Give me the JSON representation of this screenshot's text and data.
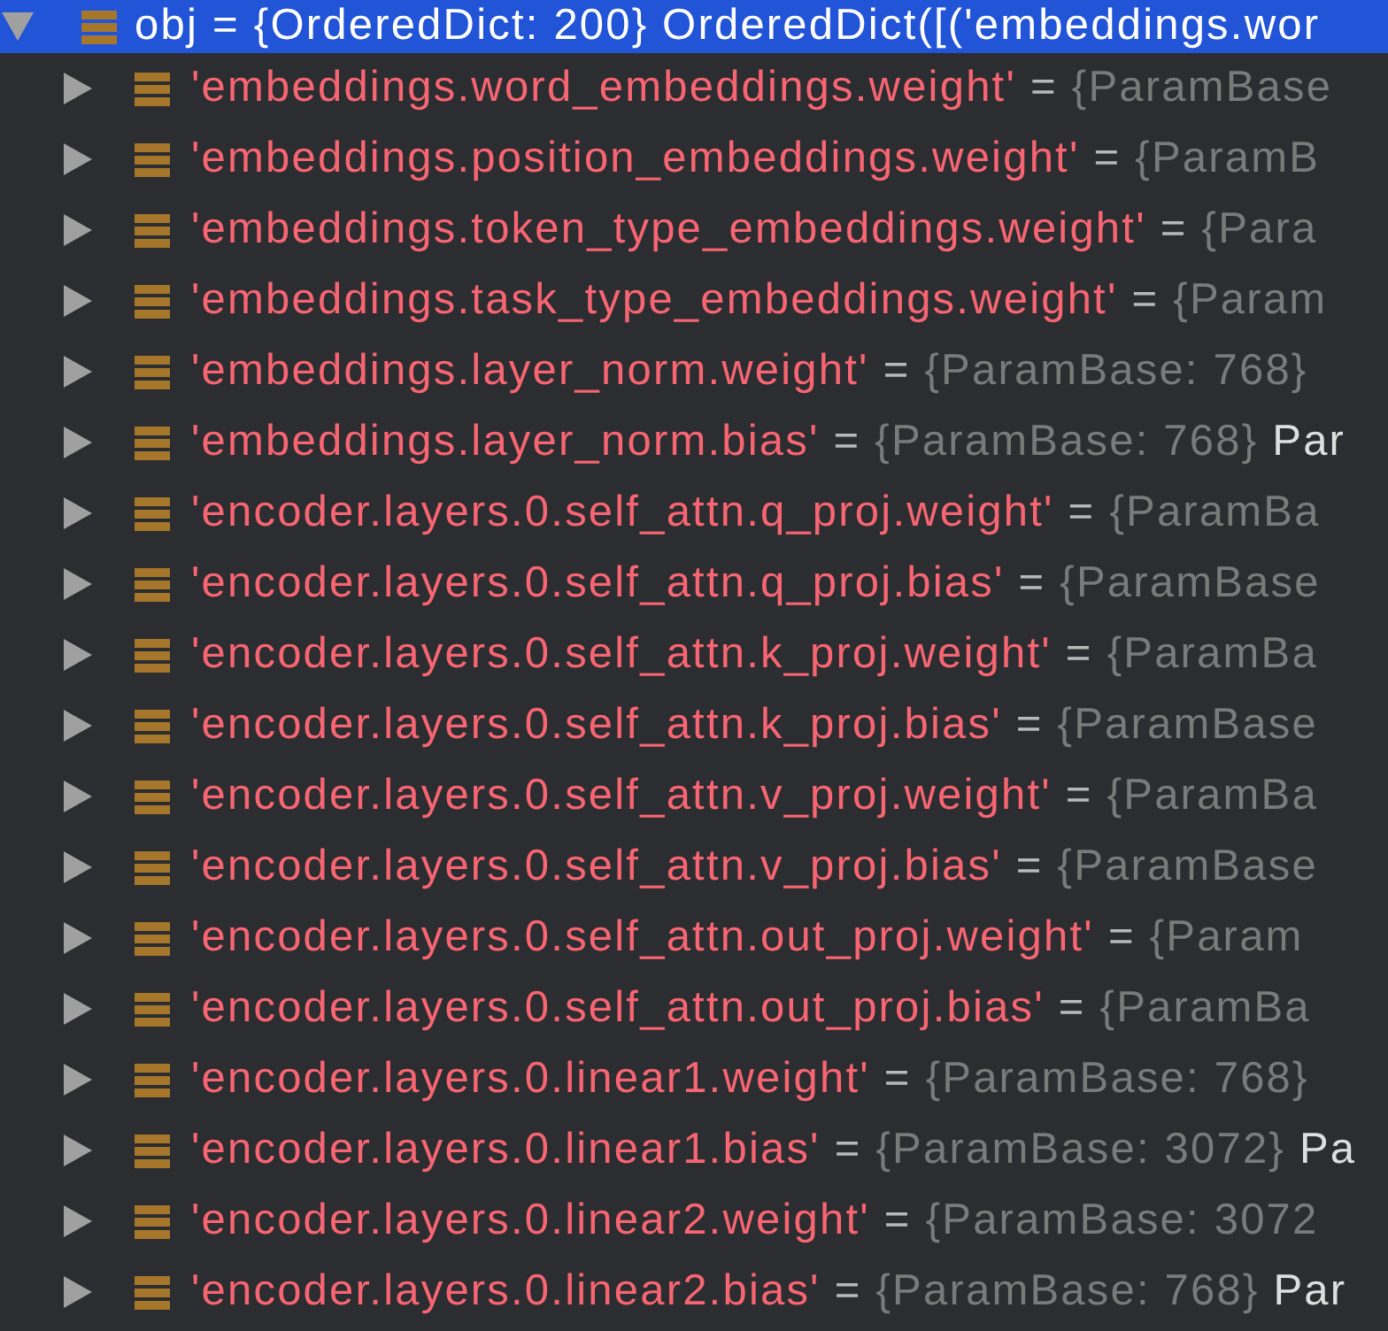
{
  "root": {
    "name": "obj",
    "sep": "=",
    "value": "{OrderedDict: 200} OrderedDict([('embeddings.wor",
    "expanded": true,
    "selected": true
  },
  "items": [
    {
      "key": "'embeddings.word_embeddings.weight'",
      "sep": "=",
      "value": "{ParamBase",
      "expanded": false,
      "selected": false
    },
    {
      "key": "'embeddings.position_embeddings.weight'",
      "sep": "=",
      "value": "{ParamB",
      "expanded": false,
      "selected": false
    },
    {
      "key": "'embeddings.token_type_embeddings.weight'",
      "sep": "=",
      "value": "{Para",
      "expanded": false,
      "selected": false
    },
    {
      "key": "'embeddings.task_type_embeddings.weight'",
      "sep": "=",
      "value": "{Param",
      "expanded": false,
      "selected": false
    },
    {
      "key": "'embeddings.layer_norm.weight'",
      "sep": "=",
      "value": "{ParamBase: 768}",
      "expanded": false,
      "selected": false
    },
    {
      "key": "'embeddings.layer_norm.bias'",
      "sep": "=",
      "value": "{ParamBase: 768}",
      "type": "Par",
      "expanded": false,
      "selected": false
    },
    {
      "key": "'encoder.layers.0.self_attn.q_proj.weight'",
      "sep": "=",
      "value": "{ParamBa",
      "expanded": false,
      "selected": false
    },
    {
      "key": "'encoder.layers.0.self_attn.q_proj.bias'",
      "sep": "=",
      "value": "{ParamBase",
      "expanded": false,
      "selected": false
    },
    {
      "key": "'encoder.layers.0.self_attn.k_proj.weight'",
      "sep": "=",
      "value": "{ParamBa",
      "expanded": false,
      "selected": false
    },
    {
      "key": "'encoder.layers.0.self_attn.k_proj.bias'",
      "sep": "=",
      "value": "{ParamBase",
      "expanded": false,
      "selected": false
    },
    {
      "key": "'encoder.layers.0.self_attn.v_proj.weight'",
      "sep": "=",
      "value": "{ParamBa",
      "expanded": false,
      "selected": false
    },
    {
      "key": "'encoder.layers.0.self_attn.v_proj.bias'",
      "sep": "=",
      "value": "{ParamBase",
      "expanded": false,
      "selected": false
    },
    {
      "key": "'encoder.layers.0.self_attn.out_proj.weight'",
      "sep": "=",
      "value": "{Param",
      "expanded": false,
      "selected": false
    },
    {
      "key": "'encoder.layers.0.self_attn.out_proj.bias'",
      "sep": "=",
      "value": "{ParamBa",
      "expanded": false,
      "selected": false
    },
    {
      "key": "'encoder.layers.0.linear1.weight'",
      "sep": "=",
      "value": "{ParamBase: 768}",
      "expanded": false,
      "selected": false
    },
    {
      "key": "'encoder.layers.0.linear1.bias'",
      "sep": "=",
      "value": "{ParamBase: 3072}",
      "type": "Pa",
      "expanded": false,
      "selected": false
    },
    {
      "key": "'encoder.layers.0.linear2.weight'",
      "sep": "=",
      "value": "{ParamBase: 3072",
      "expanded": false,
      "selected": false
    },
    {
      "key": "'encoder.layers.0.linear2.bias'",
      "sep": "=",
      "value": "{ParamBase: 768}",
      "type": "Par",
      "expanded": false,
      "selected": false
    }
  ]
}
